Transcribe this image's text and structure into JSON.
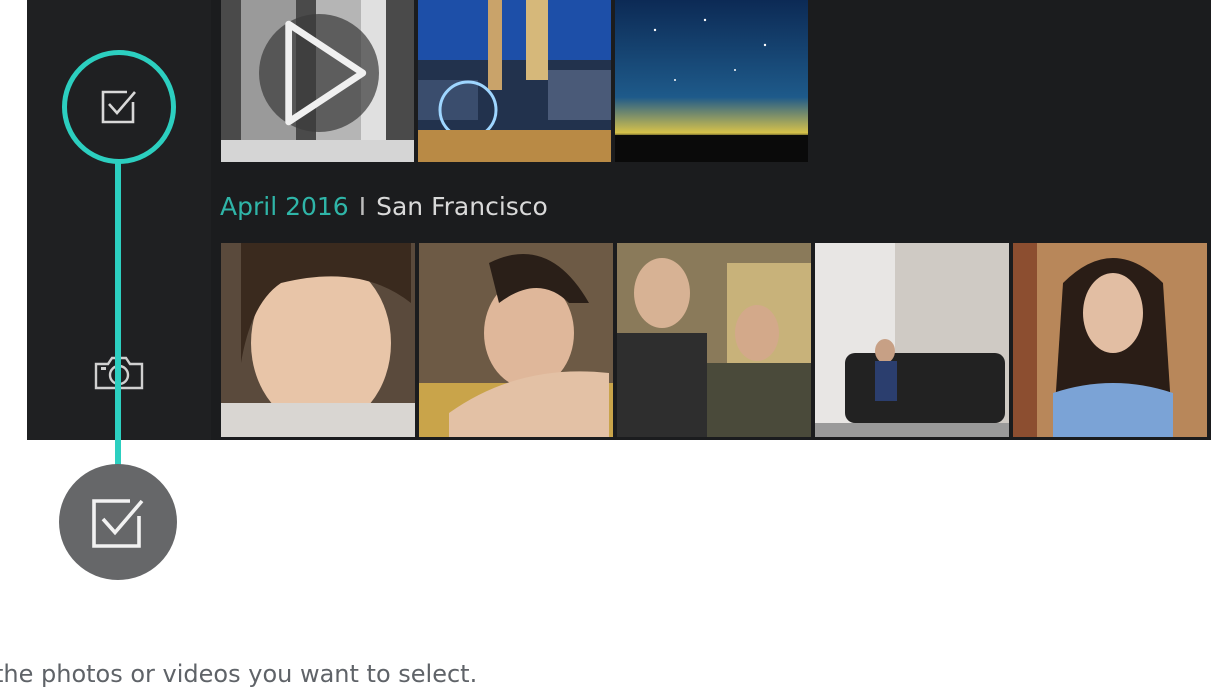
{
  "gallery": {
    "section_date": "April 2016",
    "section_separator": "I",
    "section_location": "San Francisco"
  },
  "sidebar": {
    "select_icon": "checkbox-select-icon",
    "camera_icon": "camera-icon"
  },
  "callout": {
    "icon": "checkbox-select-icon"
  },
  "caption": {
    "text": "the photos or videos you want to select."
  },
  "colors": {
    "accent": "#2ccfc0",
    "date_text": "#2fb5a8",
    "app_background": "#1b1c1e",
    "callout_circle": "#666769"
  }
}
